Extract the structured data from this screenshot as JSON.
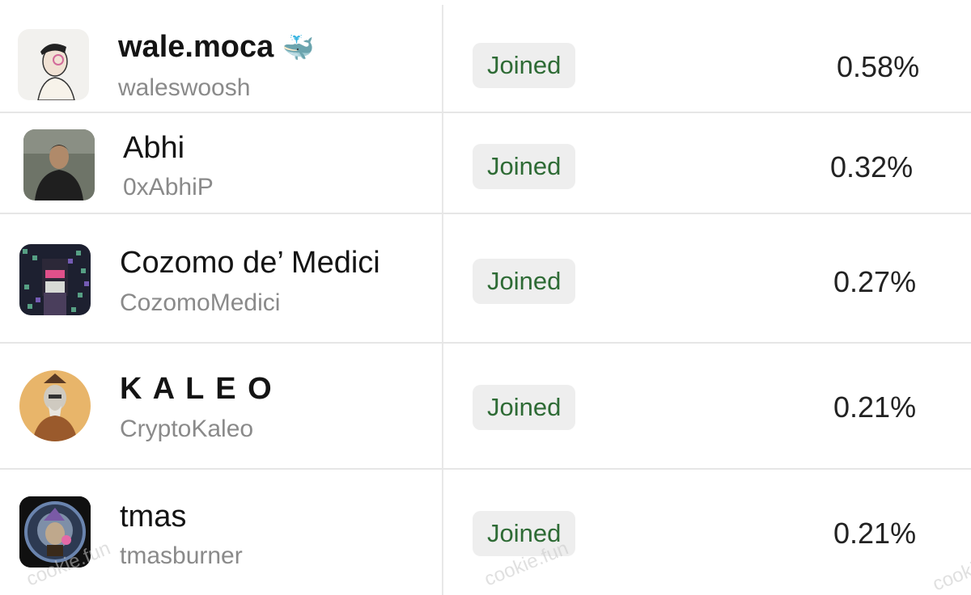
{
  "rows": [
    {
      "name": "wale.moca",
      "name_emoji": "🐳",
      "handle": "waleswoosh",
      "status": "Joined",
      "share": "0.58%"
    },
    {
      "name": "Abhi",
      "handle": "0xAbhiP",
      "status": "Joined",
      "share": "0.32%"
    },
    {
      "name": "Cozomo de’ Medici",
      "handle": "CozomoMedici",
      "status": "Joined",
      "share": "0.27%"
    },
    {
      "name": "K A L E O",
      "handle": "CryptoKaleo",
      "status": "Joined",
      "share": "0.21%"
    },
    {
      "name": "tmas",
      "handle": "tmasburner",
      "status": "Joined",
      "share": "0.21%"
    }
  ],
  "watermark": {
    "text": "cookie.fun"
  },
  "colors": {
    "badge_text": "#2e6b35",
    "badge_bg": "#eeeeee",
    "handle": "#8a8a8a",
    "divider": "#e6e6e6"
  }
}
